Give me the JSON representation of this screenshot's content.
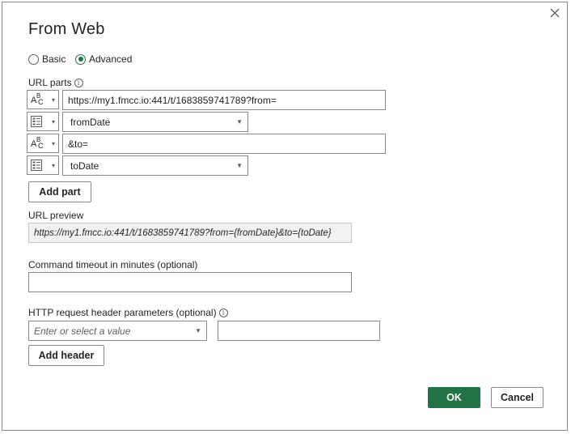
{
  "dialog": {
    "title": "From Web",
    "close_icon": "close-icon"
  },
  "mode": {
    "basic_label": "Basic",
    "advanced_label": "Advanced",
    "selected": "Advanced"
  },
  "url_parts": {
    "label": "URL parts",
    "parts": [
      {
        "type": "text",
        "type_icon": "text-type-icon",
        "value": "https://my1.fmcc.io:441/t/1683859741789?from="
      },
      {
        "type": "parameter",
        "type_icon": "parameter-type-icon",
        "value": "fromDate"
      },
      {
        "type": "text",
        "type_icon": "text-type-icon",
        "value": "&to="
      },
      {
        "type": "parameter",
        "type_icon": "parameter-type-icon",
        "value": "toDate"
      }
    ],
    "add_part_label": "Add part"
  },
  "url_preview": {
    "label": "URL preview",
    "value": "https://my1.fmcc.io:441/t/1683859741789?from={fromDate}&to={toDate}"
  },
  "timeout": {
    "label": "Command timeout in minutes (optional)",
    "value": ""
  },
  "headers": {
    "label": "HTTP request header parameters (optional)",
    "key_placeholder": "Enter or select a value",
    "value": "",
    "add_header_label": "Add header"
  },
  "footer": {
    "ok_label": "OK",
    "cancel_label": "Cancel"
  },
  "colors": {
    "accent": "#217346",
    "border": "#8a8886",
    "preview_bg": "#f3f2f1"
  }
}
